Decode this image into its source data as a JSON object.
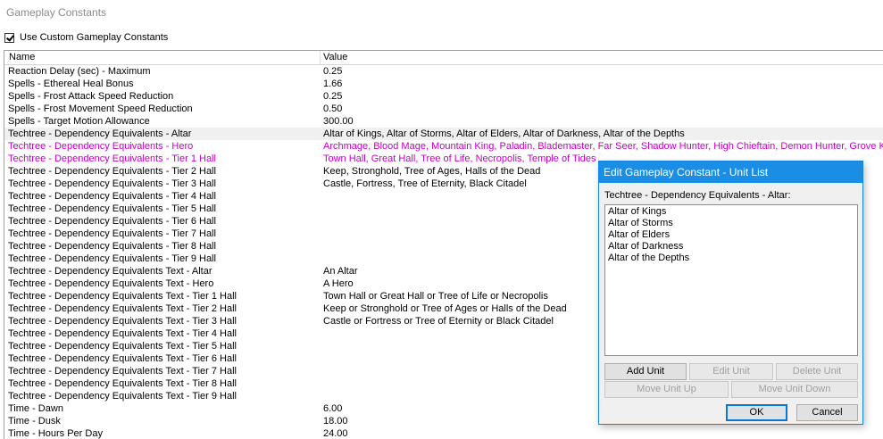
{
  "window": {
    "title": "Gameplay Constants"
  },
  "use_custom": {
    "label": "Use Custom Gameplay Constants",
    "checked": true
  },
  "columns": {
    "name": "Name",
    "value": "Value"
  },
  "rows": [
    {
      "name": "Reaction Delay (sec) - Maximum",
      "value": "0.25"
    },
    {
      "name": "Spells - Ethereal Heal Bonus",
      "value": "1.66"
    },
    {
      "name": "Spells - Frost Attack Speed Reduction",
      "value": "0.25"
    },
    {
      "name": "Spells - Frost Movement Speed Reduction",
      "value": "0.50"
    },
    {
      "name": "Spells - Target Motion Allowance",
      "value": "300.00"
    },
    {
      "name": "Techtree - Dependency Equivalents - Altar",
      "value": "Altar of Kings, Altar of Storms, Altar of Elders, Altar of Darkness, Altar of the Depths"
    },
    {
      "name": "Techtree - Dependency Equivalents - Hero",
      "value": "Archmage, Blood Mage, Mountain King, Paladin, Blademaster, Far Seer, Shadow Hunter, High Chieftain, Demon Hunter, Grove Keeper"
    },
    {
      "name": "Techtree - Dependency Equivalents - Tier 1 Hall",
      "value": "Town Hall, Great Hall, Tree of Life, Necropolis, Temple of Tides"
    },
    {
      "name": "Techtree - Dependency Equivalents - Tier 2 Hall",
      "value": "Keep, Stronghold, Tree of Ages, Halls of the Dead"
    },
    {
      "name": "Techtree - Dependency Equivalents - Tier 3 Hall",
      "value": "Castle, Fortress, Tree of Eternity, Black Citadel"
    },
    {
      "name": "Techtree - Dependency Equivalents - Tier 4 Hall",
      "value": ""
    },
    {
      "name": "Techtree - Dependency Equivalents - Tier 5 Hall",
      "value": ""
    },
    {
      "name": "Techtree - Dependency Equivalents - Tier 6 Hall",
      "value": ""
    },
    {
      "name": "Techtree - Dependency Equivalents - Tier 7 Hall",
      "value": ""
    },
    {
      "name": "Techtree - Dependency Equivalents - Tier 8 Hall",
      "value": ""
    },
    {
      "name": "Techtree - Dependency Equivalents - Tier 9 Hall",
      "value": ""
    },
    {
      "name": "Techtree - Dependency Equivalents Text - Altar",
      "value": "An Altar"
    },
    {
      "name": "Techtree - Dependency Equivalents Text - Hero",
      "value": "A Hero"
    },
    {
      "name": "Techtree - Dependency Equivalents Text - Tier 1 Hall",
      "value": "Town Hall or Great Hall or Tree of Life or Necropolis"
    },
    {
      "name": "Techtree - Dependency Equivalents Text - Tier 2 Hall",
      "value": "Keep or Stronghold or Tree of Ages or Halls of the Dead"
    },
    {
      "name": "Techtree - Dependency Equivalents Text - Tier 3 Hall",
      "value": "Castle or Fortress or Tree of Eternity or Black Citadel"
    },
    {
      "name": "Techtree - Dependency Equivalents Text - Tier 4 Hall",
      "value": ""
    },
    {
      "name": "Techtree - Dependency Equivalents Text - Tier 5 Hall",
      "value": ""
    },
    {
      "name": "Techtree - Dependency Equivalents Text - Tier 6 Hall",
      "value": ""
    },
    {
      "name": "Techtree - Dependency Equivalents Text - Tier 7 Hall",
      "value": ""
    },
    {
      "name": "Techtree - Dependency Equivalents Text - Tier 8 Hall",
      "value": ""
    },
    {
      "name": "Techtree - Dependency Equivalents Text - Tier 9 Hall",
      "value": ""
    },
    {
      "name": "Time - Dawn",
      "value": "6.00"
    },
    {
      "name": "Time - Dusk",
      "value": "18.00"
    },
    {
      "name": "Time - Hours Per Day",
      "value": "24.00"
    }
  ],
  "selected_row_index": 5,
  "modified_row_indices": [
    6,
    7
  ],
  "modified_color": "#c000c0",
  "dialog": {
    "title": "Edit Gameplay Constant - Unit List",
    "label": "Techtree - Dependency Equivalents - Altar:",
    "items": [
      "Altar of Kings",
      "Altar of Storms",
      "Altar of Elders",
      "Altar of Darkness",
      "Altar of the Depths"
    ],
    "buttons": {
      "add_unit": "Add Unit",
      "edit_unit": "Edit Unit",
      "delete_unit": "Delete Unit",
      "move_up": "Move Unit Up",
      "move_down": "Move Unit Down",
      "ok": "OK",
      "cancel": "Cancel"
    }
  }
}
